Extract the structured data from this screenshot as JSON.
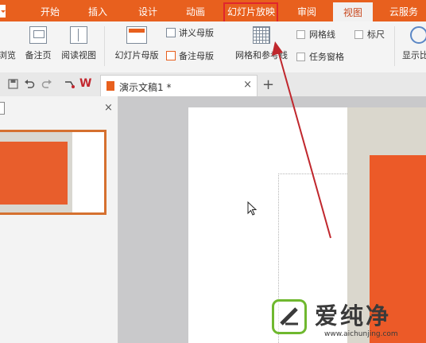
{
  "menu": {
    "tabs": [
      {
        "label": "开始"
      },
      {
        "label": "插入"
      },
      {
        "label": "设计"
      },
      {
        "label": "动画"
      },
      {
        "label": "幻灯片放映"
      },
      {
        "label": "审阅"
      },
      {
        "label": "视图",
        "active": true
      },
      {
        "label": "云服务"
      }
    ],
    "accent": "#e8601e",
    "highlight_color": "#e0262e"
  },
  "ribbon": {
    "partial_left": "浏览",
    "notes_page": "备注页",
    "reading_view": "阅读视图",
    "slide_master": "幻灯片母版",
    "handout_master": "讲义母版",
    "notes_master": "备注母版",
    "grid_and_guides": "网格和参考线",
    "gridlines": "网格线",
    "ruler": "标尺",
    "task_pane": "任务窗格",
    "display_partial": "显示比"
  },
  "docbar": {
    "app_logo_letter": "W",
    "document_tab": "演示文稿1 *",
    "close_glyph": "×",
    "new_tab_glyph": "+"
  },
  "panel": {
    "close_glyph": "×"
  },
  "watermark": {
    "brand": "爱纯净",
    "url": "www.aichunjing.com"
  },
  "icons": [
    "save-icon",
    "undo-icon",
    "redo-icon",
    "format-painter-icon",
    "wps-logo-icon",
    "document-icon",
    "mouse-cursor-icon",
    "red-arrow-annotation"
  ]
}
